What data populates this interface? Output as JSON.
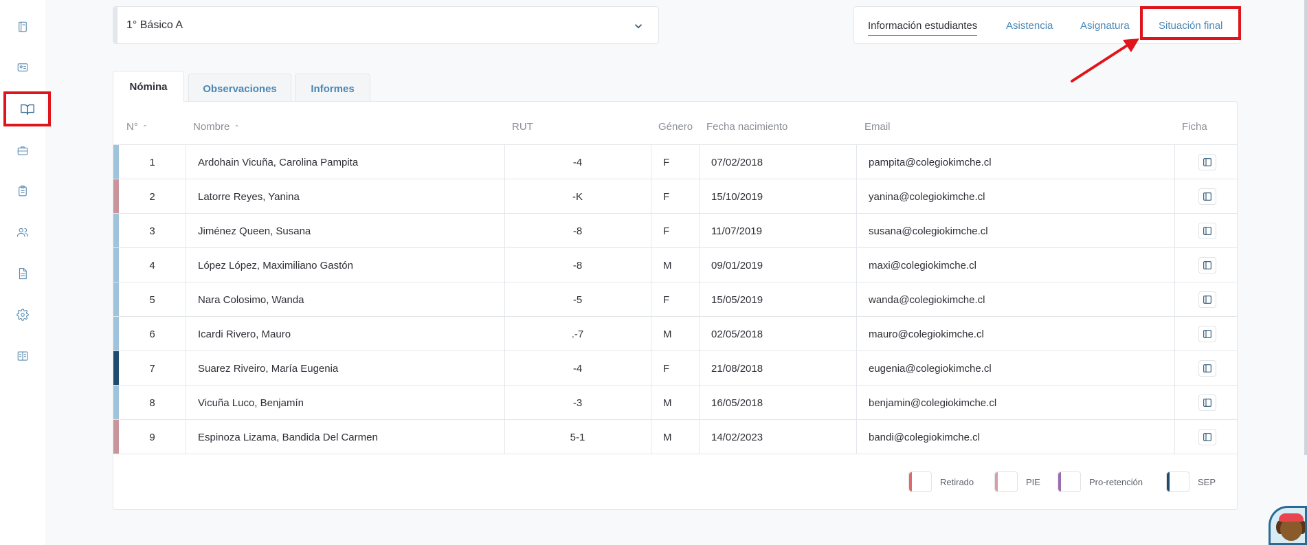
{
  "sidebar": {
    "items": [
      {
        "name": "notebook-icon"
      },
      {
        "name": "id-card-icon"
      },
      {
        "name": "open-book-icon",
        "highlighted": true
      },
      {
        "name": "briefcase-icon"
      },
      {
        "name": "clipboard-icon"
      },
      {
        "name": "users-icon"
      },
      {
        "name": "document-icon"
      },
      {
        "name": "gear-icon"
      },
      {
        "name": "manual-icon"
      }
    ]
  },
  "course_select": {
    "value": "1° Básico A"
  },
  "topnav": {
    "tabs": [
      {
        "label": "Información estudiantes",
        "active": true
      },
      {
        "label": "Asistencia"
      },
      {
        "label": "Asignatura"
      },
      {
        "label": "Situación final",
        "highlighted": true
      }
    ]
  },
  "content_tabs": [
    {
      "label": "Nómina",
      "active": true
    },
    {
      "label": "Observaciones"
    },
    {
      "label": "Informes"
    }
  ],
  "table": {
    "headers": {
      "num": "N°",
      "name": "Nombre",
      "rut": "RUT",
      "gender": "Género",
      "birth": "Fecha nacimiento",
      "email": "Email",
      "ficha": "Ficha"
    },
    "rows": [
      {
        "num": "1",
        "name": "Ardohain Vicuña, Carolina Pampita",
        "rut": "-4",
        "gender": "F",
        "birth": "07/02/2018",
        "email": "pampita@colegiokimche.cl",
        "marker": "#9fc3da"
      },
      {
        "num": "2",
        "name": "Latorre Reyes, Yanina",
        "rut": "-K",
        "gender": "F",
        "birth": "15/10/2019",
        "email": "yanina@colegiokimche.cl",
        "marker": "#c9949a"
      },
      {
        "num": "3",
        "name": "Jiménez Queen, Susana",
        "rut": "-8",
        "gender": "F",
        "birth": "11/07/2019",
        "email": "susana@colegiokimche.cl",
        "marker": "#9fc3da"
      },
      {
        "num": "4",
        "name": "López López, Maximiliano Gastón",
        "rut": "-8",
        "gender": "M",
        "birth": "09/01/2019",
        "email": "maxi@colegiokimche.cl",
        "marker": "#9fc3da"
      },
      {
        "num": "5",
        "name": "Nara Colosimo, Wanda",
        "rut": "-5",
        "gender": "F",
        "birth": "15/05/2019",
        "email": "wanda@colegiokimche.cl",
        "marker": "#9fc3da"
      },
      {
        "num": "6",
        "name": "Icardi Rivero, Mauro",
        "rut": ".-7",
        "gender": "M",
        "birth": "02/05/2018",
        "email": "mauro@colegiokimche.cl",
        "marker": "#9fc3da"
      },
      {
        "num": "7",
        "name": "Suarez Riveiro, María Eugenia",
        "rut": "-4",
        "gender": "F",
        "birth": "21/08/2018",
        "email": "eugenia@colegiokimche.cl",
        "marker": "#1f4b6e"
      },
      {
        "num": "8",
        "name": "Vicuña Luco, Benjamín",
        "rut": "-3",
        "gender": "M",
        "birth": "16/05/2018",
        "email": "benjamin@colegiokimche.cl",
        "marker": "#9fc3da"
      },
      {
        "num": "9",
        "name": "Espinoza Lizama, Bandida Del Carmen",
        "rut": "5-1",
        "gender": "M",
        "birth": "14/02/2023",
        "email": "bandi@colegiokimche.cl",
        "marker": "#c9949a"
      }
    ]
  },
  "legend": [
    {
      "label": "Retirado",
      "color": "#e06a6a"
    },
    {
      "label": "PIE",
      "color": "#d4a0a6"
    },
    {
      "label": "Pro-retención",
      "color": "#9b6bb0"
    },
    {
      "label": "SEP",
      "color": "#1f4b6e"
    }
  ]
}
